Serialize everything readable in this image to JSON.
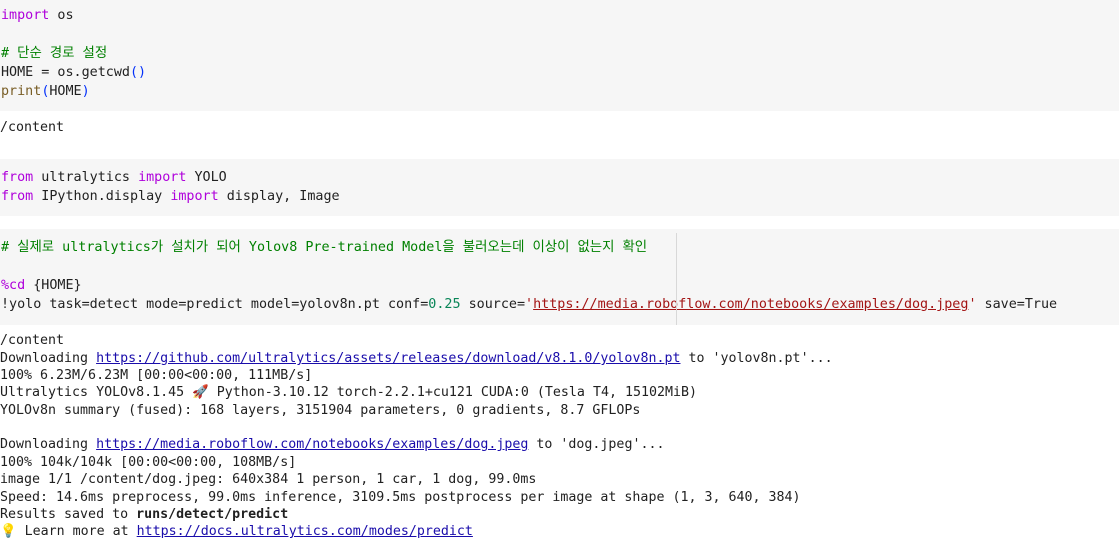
{
  "cell1": {
    "line1": {
      "kw": "import",
      "rest": " os"
    },
    "line2": {
      "comment": "# 단순 경로 설정"
    },
    "line3": {
      "lhs": "HOME = os.getcwd",
      "paren": "()"
    },
    "line4": {
      "fn": "print",
      "open": "(",
      "arg": "HOME",
      "close": ")"
    }
  },
  "out1": {
    "line1": "/content"
  },
  "cell2": {
    "line1": {
      "kw1": "from",
      "mod": " ultralytics ",
      "kw2": "import",
      "rest": " YOLO"
    },
    "line2": {
      "kw1": "from",
      "mod": " IPython.display ",
      "kw2": "import",
      "rest": " display, Image"
    }
  },
  "cell3": {
    "line1": {
      "comment": "# 실제로 ultralytics가 설치가 되어 Yolov8 Pre-trained Model을 불러오는데 이상이 없는지 확인"
    },
    "line2": {
      "magic": "%cd",
      "rest": " {HOME}"
    },
    "line3": {
      "pre": "!yolo task=detect mode=predict model=yolov8n.pt conf=",
      "num": "0.25",
      "mid": " source=",
      "q1": "'",
      "url": "https://media.roboflow.com/notebooks/examples/dog.jpeg",
      "q2": "'",
      "post": " save=True"
    }
  },
  "out3": {
    "l1": "/content",
    "l2_pre": "Downloading ",
    "l2_link": "https://github.com/ultralytics/assets/releases/download/v8.1.0/yolov8n.pt",
    "l2_post": " to 'yolov8n.pt'...",
    "l3": "100% 6.23M/6.23M [00:00<00:00, 111MB/s]",
    "l4": "Ultralytics YOLOv8.1.45 🚀 Python-3.10.12 torch-2.2.1+cu121 CUDA:0 (Tesla T4, 15102MiB)",
    "l5": "YOLOv8n summary (fused): 168 layers, 3151904 parameters, 0 gradients, 8.7 GFLOPs",
    "l6_pre": "Downloading ",
    "l6_link": "https://media.roboflow.com/notebooks/examples/dog.jpeg",
    "l6_post": " to 'dog.jpeg'...",
    "l7": "100% 104k/104k [00:00<00:00, 108MB/s]",
    "l8": "image 1/1 /content/dog.jpeg: 640x384 1 person, 1 car, 1 dog, 99.0ms",
    "l9": "Speed: 14.6ms preprocess, 99.0ms inference, 3109.5ms postprocess per image at shape (1, 3, 640, 384)",
    "l10_pre": "Results saved to ",
    "l10_bold": "runs/detect/predict",
    "l11_icon": "💡",
    "l11_pre": " Learn more at ",
    "l11_link": "https://docs.ultralytics.com/modes/predict"
  }
}
